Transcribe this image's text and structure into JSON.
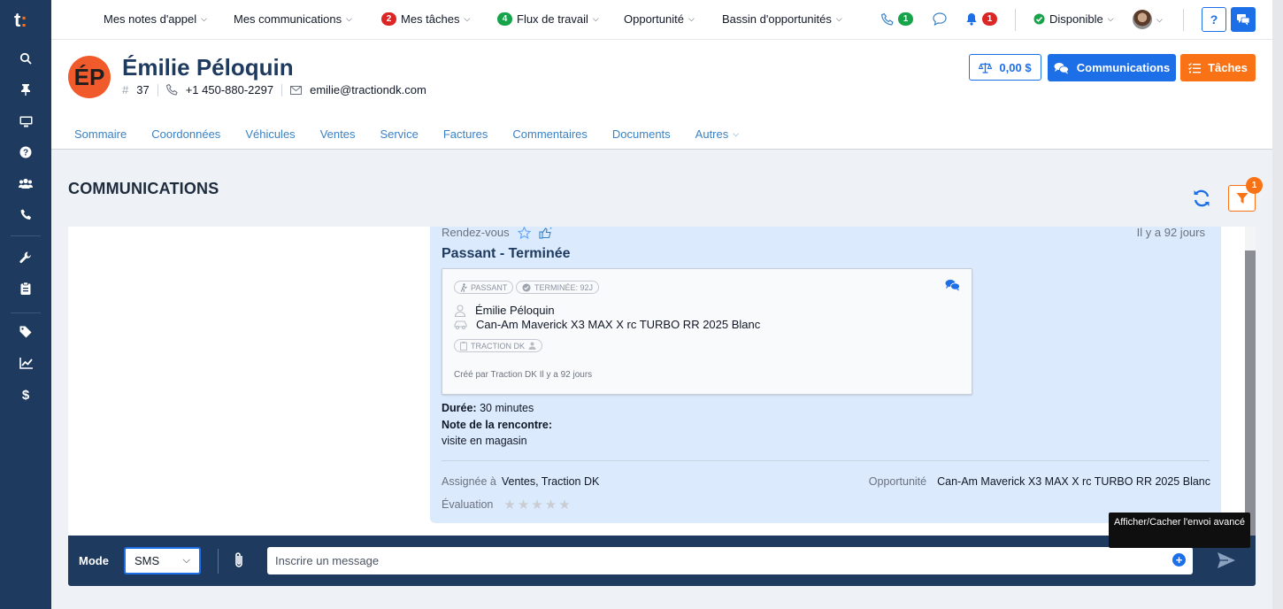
{
  "topnav": {
    "items": [
      {
        "label": "Mes notes d'appel"
      },
      {
        "label": "Mes communications"
      },
      {
        "label": "Mes tâches",
        "badge": "2"
      },
      {
        "label": "Flux de travail",
        "badge": "4"
      },
      {
        "label": "Opportunité"
      },
      {
        "label": "Bassin d'opportunités"
      }
    ],
    "calls_badge": "1",
    "notifications_badge": "1",
    "status": "Disponible",
    "help": "?"
  },
  "client": {
    "initials": "ÉP",
    "name": "Émilie Péloquin",
    "id": "37",
    "phone": "+1 450-880-2297",
    "email": "emilie@tractiondk.com"
  },
  "header_buttons": {
    "balance": "0,00 $",
    "communications": "Communications",
    "tasks": "Tâches"
  },
  "tabs": [
    "Sommaire",
    "Coordonnées",
    "Véhicules",
    "Ventes",
    "Service",
    "Factures",
    "Commentaires",
    "Documents",
    "Autres"
  ],
  "section": {
    "title": "COMMUNICATIONS",
    "filter_badge": "1"
  },
  "message": {
    "type": "Rendez-vous",
    "time": "Il y a 92 jours",
    "title": "Passant - Terminée",
    "pills": {
      "walkin": "PASSANT",
      "status": "TERMINÉE: 92J",
      "dealer": "TRACTION DK"
    },
    "contact": "Émilie Péloquin",
    "vehicle": "Can-Am Maverick X3 MAX X rc TURBO RR 2025 Blanc",
    "created": "Créé par Traction DK Il y a 92 jours",
    "duration_label": "Durée:",
    "duration_value": "30 minutes",
    "note_label": "Note de la rencontre:",
    "note_value": "visite en magasin",
    "assigned_label": "Assignée à",
    "assigned_value": "Ventes, Traction DK",
    "opportunity_label": "Opportunité",
    "opportunity_value": "Can-Am Maverick X3 MAX X rc TURBO RR 2025 Blanc",
    "rating_label": "Évaluation",
    "rating": 0
  },
  "composer": {
    "mode_label": "Mode",
    "mode_value": "SMS",
    "placeholder": "Inscrire un message",
    "tooltip": "Afficher/Cacher l'envoi avancé"
  },
  "colors": {
    "primary": "#1d6fe8",
    "accent": "#f97316",
    "sidebar": "#1e3a5f",
    "message_bg": "#dbeafc"
  }
}
